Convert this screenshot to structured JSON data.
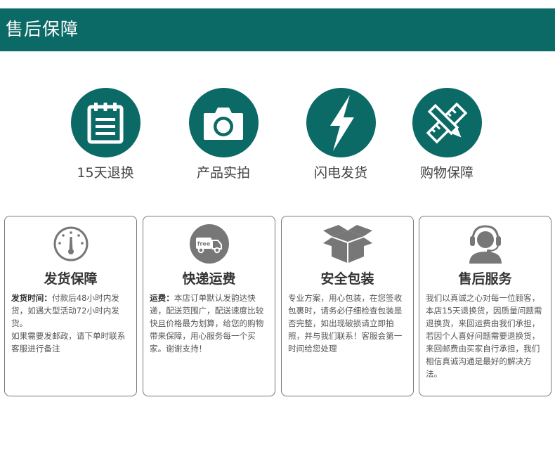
{
  "header": {
    "title": "售后保障"
  },
  "features": [
    {
      "label": "15天退换",
      "icon": "clipboard-icon"
    },
    {
      "label": "产品实拍",
      "icon": "camera-icon"
    },
    {
      "label": "闪电发货",
      "icon": "lightning-icon"
    },
    {
      "label": "购物保障",
      "icon": "pencil-ruler-icon"
    }
  ],
  "cards": [
    {
      "title": "发货保障",
      "icon": "speedometer-icon",
      "lead": "发货时间：",
      "text": "付款后48小时内发货，如遇大型活动72小时内发货。",
      "text2": "如果需要发邮政，请下单时联系客服进行备注"
    },
    {
      "title": "快递运费",
      "icon": "free-truck-icon",
      "icon_text": "free",
      "lead": "运费：",
      "text": "本店订单默认发韵达快递，配送范围广，配送速度比较快且价格最为划算，给您的购物带来保障，用心服务每一个买家。谢谢支持！"
    },
    {
      "title": "安全包装",
      "icon": "open-box-icon",
      "text": "专业方案，用心包装，在您签收包裹时，请务必仔细检查包装是否完整，如出现破损请立即拍照，并与我们联系！客服会第一时间给您处理"
    },
    {
      "title": "售后服务",
      "icon": "headset-agent-icon",
      "text": "我们以真诚之心对每一位顾客，本店15天退换货，因质量问题需退换货，来回运费由我们承担，若因个人喜好问题需要退换货，来回邮费由买家自行承担，我们相信真诚沟通是最好的解决方法。"
    }
  ],
  "colors": {
    "brand": "#0b6a66",
    "icon_gray": "#777777",
    "border": "#777777"
  }
}
